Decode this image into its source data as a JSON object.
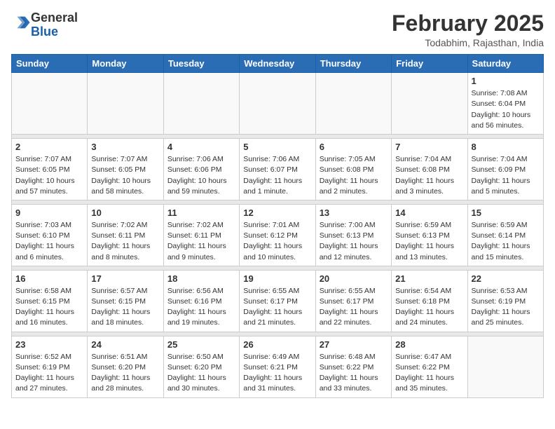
{
  "header": {
    "logo_general": "General",
    "logo_blue": "Blue",
    "month_title": "February 2025",
    "location": "Todabhim, Rajasthan, India"
  },
  "weekdays": [
    "Sunday",
    "Monday",
    "Tuesday",
    "Wednesday",
    "Thursday",
    "Friday",
    "Saturday"
  ],
  "weeks": [
    [
      {
        "day": "",
        "info": ""
      },
      {
        "day": "",
        "info": ""
      },
      {
        "day": "",
        "info": ""
      },
      {
        "day": "",
        "info": ""
      },
      {
        "day": "",
        "info": ""
      },
      {
        "day": "",
        "info": ""
      },
      {
        "day": "1",
        "info": "Sunrise: 7:08 AM\nSunset: 6:04 PM\nDaylight: 10 hours\nand 56 minutes."
      }
    ],
    [
      {
        "day": "2",
        "info": "Sunrise: 7:07 AM\nSunset: 6:05 PM\nDaylight: 10 hours\nand 57 minutes."
      },
      {
        "day": "3",
        "info": "Sunrise: 7:07 AM\nSunset: 6:05 PM\nDaylight: 10 hours\nand 58 minutes."
      },
      {
        "day": "4",
        "info": "Sunrise: 7:06 AM\nSunset: 6:06 PM\nDaylight: 10 hours\nand 59 minutes."
      },
      {
        "day": "5",
        "info": "Sunrise: 7:06 AM\nSunset: 6:07 PM\nDaylight: 11 hours\nand 1 minute."
      },
      {
        "day": "6",
        "info": "Sunrise: 7:05 AM\nSunset: 6:08 PM\nDaylight: 11 hours\nand 2 minutes."
      },
      {
        "day": "7",
        "info": "Sunrise: 7:04 AM\nSunset: 6:08 PM\nDaylight: 11 hours\nand 3 minutes."
      },
      {
        "day": "8",
        "info": "Sunrise: 7:04 AM\nSunset: 6:09 PM\nDaylight: 11 hours\nand 5 minutes."
      }
    ],
    [
      {
        "day": "9",
        "info": "Sunrise: 7:03 AM\nSunset: 6:10 PM\nDaylight: 11 hours\nand 6 minutes."
      },
      {
        "day": "10",
        "info": "Sunrise: 7:02 AM\nSunset: 6:11 PM\nDaylight: 11 hours\nand 8 minutes."
      },
      {
        "day": "11",
        "info": "Sunrise: 7:02 AM\nSunset: 6:11 PM\nDaylight: 11 hours\nand 9 minutes."
      },
      {
        "day": "12",
        "info": "Sunrise: 7:01 AM\nSunset: 6:12 PM\nDaylight: 11 hours\nand 10 minutes."
      },
      {
        "day": "13",
        "info": "Sunrise: 7:00 AM\nSunset: 6:13 PM\nDaylight: 11 hours\nand 12 minutes."
      },
      {
        "day": "14",
        "info": "Sunrise: 6:59 AM\nSunset: 6:13 PM\nDaylight: 11 hours\nand 13 minutes."
      },
      {
        "day": "15",
        "info": "Sunrise: 6:59 AM\nSunset: 6:14 PM\nDaylight: 11 hours\nand 15 minutes."
      }
    ],
    [
      {
        "day": "16",
        "info": "Sunrise: 6:58 AM\nSunset: 6:15 PM\nDaylight: 11 hours\nand 16 minutes."
      },
      {
        "day": "17",
        "info": "Sunrise: 6:57 AM\nSunset: 6:15 PM\nDaylight: 11 hours\nand 18 minutes."
      },
      {
        "day": "18",
        "info": "Sunrise: 6:56 AM\nSunset: 6:16 PM\nDaylight: 11 hours\nand 19 minutes."
      },
      {
        "day": "19",
        "info": "Sunrise: 6:55 AM\nSunset: 6:17 PM\nDaylight: 11 hours\nand 21 minutes."
      },
      {
        "day": "20",
        "info": "Sunrise: 6:55 AM\nSunset: 6:17 PM\nDaylight: 11 hours\nand 22 minutes."
      },
      {
        "day": "21",
        "info": "Sunrise: 6:54 AM\nSunset: 6:18 PM\nDaylight: 11 hours\nand 24 minutes."
      },
      {
        "day": "22",
        "info": "Sunrise: 6:53 AM\nSunset: 6:19 PM\nDaylight: 11 hours\nand 25 minutes."
      }
    ],
    [
      {
        "day": "23",
        "info": "Sunrise: 6:52 AM\nSunset: 6:19 PM\nDaylight: 11 hours\nand 27 minutes."
      },
      {
        "day": "24",
        "info": "Sunrise: 6:51 AM\nSunset: 6:20 PM\nDaylight: 11 hours\nand 28 minutes."
      },
      {
        "day": "25",
        "info": "Sunrise: 6:50 AM\nSunset: 6:20 PM\nDaylight: 11 hours\nand 30 minutes."
      },
      {
        "day": "26",
        "info": "Sunrise: 6:49 AM\nSunset: 6:21 PM\nDaylight: 11 hours\nand 31 minutes."
      },
      {
        "day": "27",
        "info": "Sunrise: 6:48 AM\nSunset: 6:22 PM\nDaylight: 11 hours\nand 33 minutes."
      },
      {
        "day": "28",
        "info": "Sunrise: 6:47 AM\nSunset: 6:22 PM\nDaylight: 11 hours\nand 35 minutes."
      },
      {
        "day": "",
        "info": ""
      }
    ]
  ]
}
